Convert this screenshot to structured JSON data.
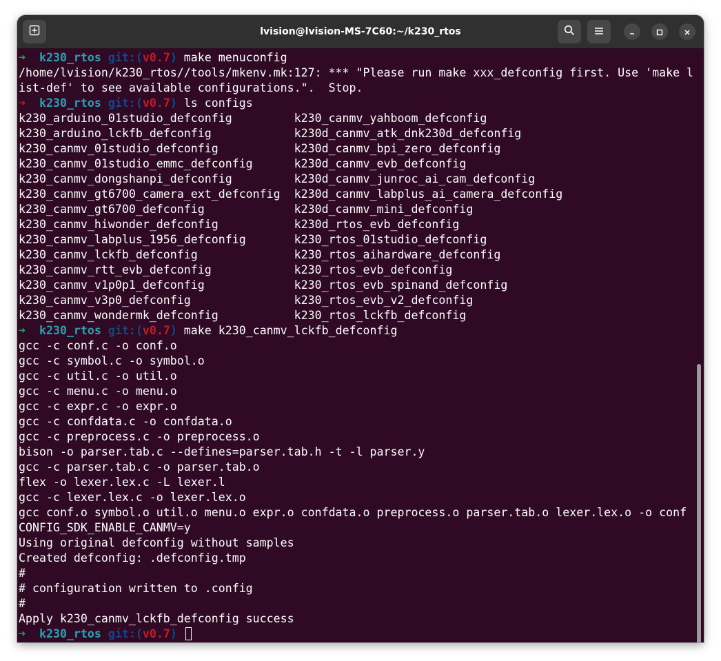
{
  "window": {
    "title": "lvision@lvision-MS-7C60:~/k230_rtos"
  },
  "titlebar_icons": {
    "new_tab": "new-tab-icon",
    "search": "search-icon",
    "menu": "hamburger-menu-icon",
    "minimize": "minimize-icon",
    "maximize": "maximize-icon",
    "close": "close-icon"
  },
  "colors": {
    "terminal_bg": "#300a24",
    "titlebar_bg": "#303030",
    "prompt_ok": "#26a269",
    "prompt_err": "#c01c28",
    "directory": "#2aa1b3",
    "git": "#12488b",
    "branch": "#c01c28"
  },
  "prompt": {
    "arrow": "➜",
    "dir": "k230_rtos",
    "git_open": "git:(",
    "branch": "v0.7",
    "git_close": ")"
  },
  "terminal": {
    "lines": [
      {
        "type": "prompt",
        "status": "ok",
        "command": " make menuconfig"
      },
      {
        "type": "output",
        "text": "/home/lvision/k230_rtos//tools/mkenv.mk:127: *** \"Please run make xxx_defconfig first. Use 'make l"
      },
      {
        "type": "output",
        "text": "ist-def' to see available configurations.\".  Stop."
      },
      {
        "type": "prompt",
        "status": "err",
        "command": " ls configs"
      },
      {
        "type": "output",
        "text": "k230_arduino_01studio_defconfig         k230_canmv_yahboom_defconfig"
      },
      {
        "type": "output",
        "text": "k230_arduino_lckfb_defconfig            k230d_canmv_atk_dnk230d_defconfig"
      },
      {
        "type": "output",
        "text": "k230_canmv_01studio_defconfig           k230d_canmv_bpi_zero_defconfig"
      },
      {
        "type": "output",
        "text": "k230_canmv_01studio_emmc_defconfig      k230d_canmv_evb_defconfig"
      },
      {
        "type": "output",
        "text": "k230_canmv_dongshanpi_defconfig         k230d_canmv_junroc_ai_cam_defconfig"
      },
      {
        "type": "output",
        "text": "k230_canmv_gt6700_camera_ext_defconfig  k230d_canmv_labplus_ai_camera_defconfig"
      },
      {
        "type": "output",
        "text": "k230_canmv_gt6700_defconfig             k230d_canmv_mini_defconfig"
      },
      {
        "type": "output",
        "text": "k230_canmv_hiwonder_defconfig           k230d_rtos_evb_defconfig"
      },
      {
        "type": "output",
        "text": "k230_canmv_labplus_1956_defconfig       k230_rtos_01studio_defconfig"
      },
      {
        "type": "output",
        "text": "k230_canmv_lckfb_defconfig              k230_rtos_aihardware_defconfig"
      },
      {
        "type": "output",
        "text": "k230_canmv_rtt_evb_defconfig            k230_rtos_evb_defconfig"
      },
      {
        "type": "output",
        "text": "k230_canmv_v1p0p1_defconfig             k230_rtos_evb_spinand_defconfig"
      },
      {
        "type": "output",
        "text": "k230_canmv_v3p0_defconfig               k230_rtos_evb_v2_defconfig"
      },
      {
        "type": "output",
        "text": "k230_canmv_wondermk_defconfig           k230_rtos_lckfb_defconfig"
      },
      {
        "type": "prompt",
        "status": "ok",
        "command": " make k230_canmv_lckfb_defconfig"
      },
      {
        "type": "output",
        "text": "gcc -c conf.c -o conf.o"
      },
      {
        "type": "output",
        "text": "gcc -c symbol.c -o symbol.o"
      },
      {
        "type": "output",
        "text": "gcc -c util.c -o util.o"
      },
      {
        "type": "output",
        "text": "gcc -c menu.c -o menu.o"
      },
      {
        "type": "output",
        "text": "gcc -c expr.c -o expr.o"
      },
      {
        "type": "output",
        "text": "gcc -c confdata.c -o confdata.o"
      },
      {
        "type": "output",
        "text": "gcc -c preprocess.c -o preprocess.o"
      },
      {
        "type": "output",
        "text": "bison -o parser.tab.c --defines=parser.tab.h -t -l parser.y"
      },
      {
        "type": "output",
        "text": "gcc -c parser.tab.c -o parser.tab.o"
      },
      {
        "type": "output",
        "text": "flex -o lexer.lex.c -L lexer.l"
      },
      {
        "type": "output",
        "text": "gcc -c lexer.lex.c -o lexer.lex.o"
      },
      {
        "type": "output",
        "text": "gcc conf.o symbol.o util.o menu.o expr.o confdata.o preprocess.o parser.tab.o lexer.lex.o -o conf"
      },
      {
        "type": "output",
        "text": "CONFIG_SDK_ENABLE_CANMV=y"
      },
      {
        "type": "output",
        "text": "Using original defconfig without samples"
      },
      {
        "type": "output",
        "text": "Created defconfig: .defconfig.tmp"
      },
      {
        "type": "output",
        "text": "#"
      },
      {
        "type": "output",
        "text": "# configuration written to .config"
      },
      {
        "type": "output",
        "text": "#"
      },
      {
        "type": "output",
        "text": "Apply k230_canmv_lckfb_defconfig success"
      },
      {
        "type": "prompt",
        "status": "ok",
        "command": " ",
        "cursor": true
      }
    ]
  }
}
